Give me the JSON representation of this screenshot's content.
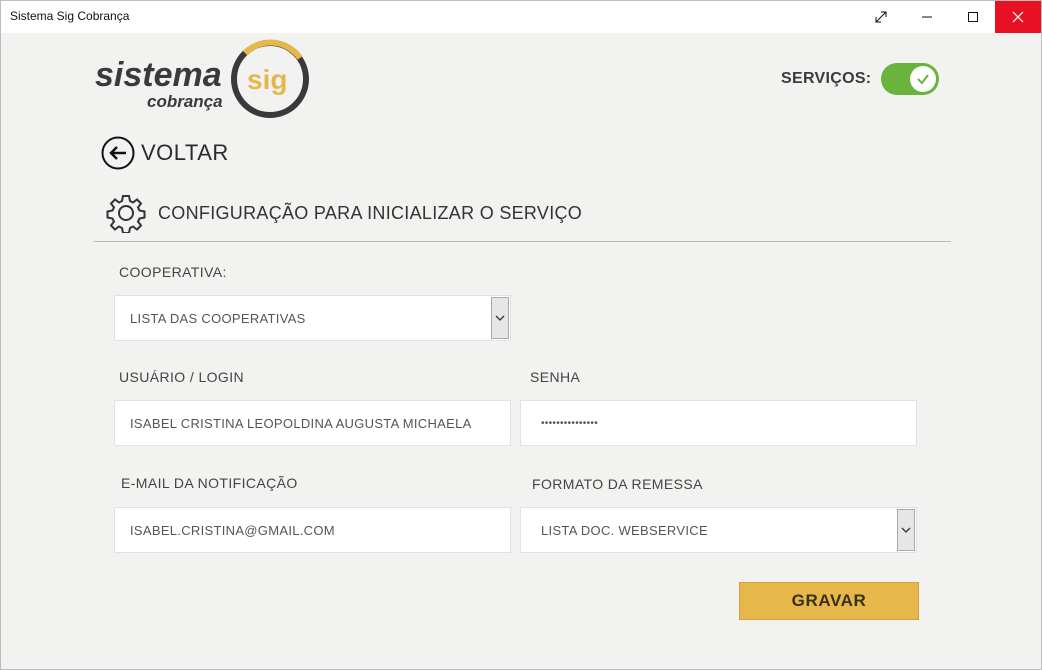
{
  "window": {
    "title": "Sistema Sig Cobrança"
  },
  "titlebar_icons": [
    "expand-icon",
    "minimize-icon",
    "maximize-icon",
    "close-icon"
  ],
  "logo": {
    "word1": "sistema",
    "word2": "sig",
    "word3": "cobrança"
  },
  "services": {
    "label": "SERVIÇOS:",
    "enabled": true
  },
  "back": {
    "label": "VOLTAR"
  },
  "section": {
    "title": "CONFIGURAÇÃO PARA INICIALIZAR O SERVIÇO"
  },
  "form": {
    "cooperativa": {
      "label": "COOPERATIVA:",
      "value": "LISTA DAS COOPERATIVAS"
    },
    "usuario": {
      "label": "USUÁRIO / LOGIN",
      "value": "ISABEL CRISTINA LEOPOLDINA AUGUSTA MICHAELA"
    },
    "senha": {
      "label": "SENHA",
      "value": "•••••••••••••••"
    },
    "email": {
      "label": "E-MAIL DA NOTIFICAÇÃO",
      "value": "ISABEL.CRISTINA@GMAIL.COM"
    },
    "formato": {
      "label": "FORMATO DA REMESSA",
      "value": "LISTA DOC. WEBSERVICE"
    }
  },
  "actions": {
    "save_label": "GRAVAR"
  },
  "colors": {
    "accent": "#e6b84b",
    "toggle_on": "#6ab43e",
    "close_hover": "#e81123",
    "logo_dark": "#3a3a3a"
  }
}
